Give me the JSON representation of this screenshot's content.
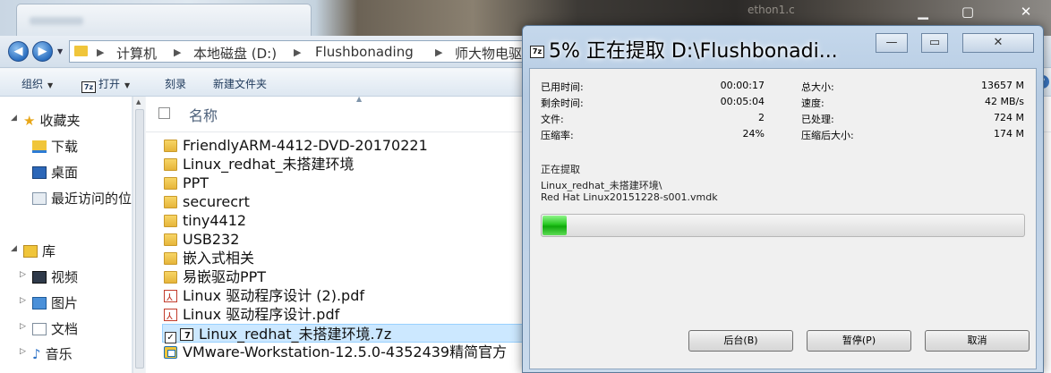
{
  "background_window": {
    "title": "ethon1.c",
    "controls": [
      "▁",
      "▢",
      "✕"
    ]
  },
  "explorer": {
    "breadcrumb": [
      "计算机",
      "本地磁盘 (D:)",
      "Flushbonading",
      "师大物电驱"
    ],
    "toolbar": {
      "organize": "组织",
      "open": "打开",
      "burn": "刻录",
      "new_folder": "新建文件夹",
      "open_icon": "7z"
    },
    "nav": {
      "favorites": "收藏夹",
      "downloads": "下载",
      "desktop": "桌面",
      "recent": "最近访问的位",
      "libraries": "库",
      "videos": "视频",
      "pictures": "图片",
      "documents": "文档",
      "music": "音乐"
    },
    "column_name": "名称",
    "files": [
      {
        "name": "FriendlyARM-4412-DVD-20170221",
        "type": "folder"
      },
      {
        "name": "Linux_redhat_未搭建环境",
        "type": "folder"
      },
      {
        "name": "PPT",
        "type": "folder"
      },
      {
        "name": "securecrt",
        "type": "folder"
      },
      {
        "name": "tiny4412",
        "type": "folder"
      },
      {
        "name": "USB232",
        "type": "folder"
      },
      {
        "name": "嵌入式相关",
        "type": "folder"
      },
      {
        "name": "易嵌驱动PPT",
        "type": "folder"
      },
      {
        "name": "Linux 驱动程序设计 (2).pdf",
        "type": "pdf"
      },
      {
        "name": "Linux 驱动程序设计.pdf",
        "type": "pdf"
      },
      {
        "name": "Linux_redhat_未搭建环境.7z",
        "type": "7z",
        "selected": true
      },
      {
        "name": "VMware-Workstation-12.5.0-4352439精简官方",
        "type": "exe"
      }
    ]
  },
  "dialog": {
    "title": "5% 正在提取 D:\\Flushbonadi...",
    "app_icon": "7z",
    "controls": {
      "minimize": "—",
      "maximize": "▭",
      "close": "✕"
    },
    "stats": {
      "elapsed_label": "已用时间:",
      "elapsed": "00:00:17",
      "remaining_label": "剩余时间:",
      "remaining": "00:05:04",
      "files_label": "文件:",
      "files": "2",
      "ratio_label": "压缩率:",
      "ratio": "24%",
      "total_label": "总大小:",
      "total": "13657 M",
      "speed_label": "速度:",
      "speed": "42 MB/s",
      "processed_label": "已处理:",
      "processed": "724 M",
      "compressed_label": "压缩后大小:",
      "compressed": "174 M"
    },
    "status_label": "正在提取",
    "current_path_line1": "Linux_redhat_未搭建环境\\",
    "current_path_line2": "Red Hat Linux20151228-s001.vmdk",
    "progress_fraction": 0.05,
    "buttons": {
      "background": "后台(B)",
      "pause": "暂停(P)",
      "cancel": "取消"
    }
  }
}
